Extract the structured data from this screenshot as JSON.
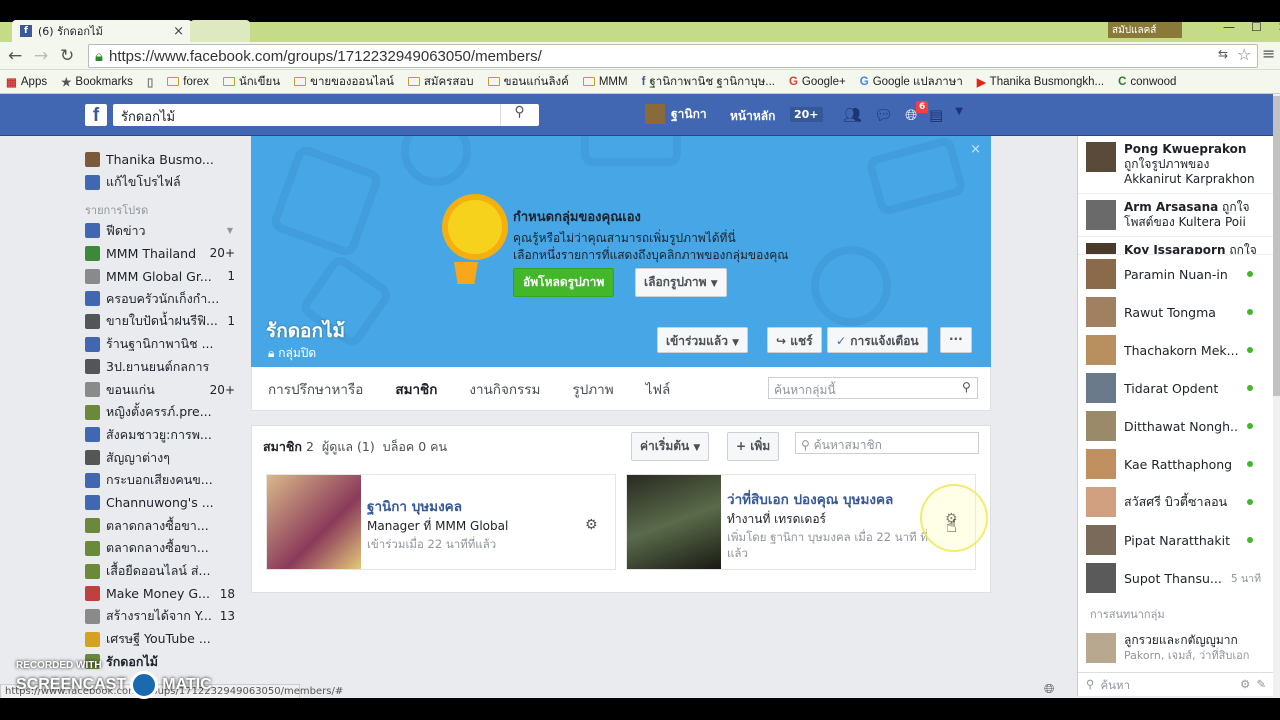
{
  "browser": {
    "tab_title": "(6) รักดอกไม้",
    "tab2_title": "",
    "extension_label": "สมัปแลคส์",
    "url": "https://www.facebook.com/groups/1712232949063050/members/",
    "status_url": "https://www.facebook.com/groups/1712232949063050/members/#",
    "bookmarks": [
      {
        "label": "Apps",
        "icon": "apps-icon"
      },
      {
        "label": "Bookmarks",
        "icon": "star-icon"
      },
      {
        "label": "",
        "icon": "page-icon"
      },
      {
        "label": "forex",
        "icon": "folder-icon"
      },
      {
        "label": "นักเขียน",
        "icon": "folder-icon"
      },
      {
        "label": "ขายของออนไลน์",
        "icon": "folder-icon"
      },
      {
        "label": "สมัครสอบ",
        "icon": "folder-icon"
      },
      {
        "label": "ขอนแก่นลิงค์",
        "icon": "folder-icon"
      },
      {
        "label": "MMM",
        "icon": "folder-icon"
      },
      {
        "label": "ฐานิกาพานิช ฐานิกาบุษ...",
        "icon": "facebook-icon"
      },
      {
        "label": "Google+",
        "icon": "googleplus-icon"
      },
      {
        "label": "Google แปลภาษา",
        "icon": "translate-icon"
      },
      {
        "label": "Thanika Busmongkh...",
        "icon": "youtube-icon"
      },
      {
        "label": "conwood",
        "icon": "conwood-icon"
      }
    ]
  },
  "fb": {
    "search_value": "รักดอกไม้",
    "user_name": "ฐานิกา",
    "home_label": "หน้าหลัก",
    "home_count": "20+",
    "notif_count": "6"
  },
  "left": {
    "profile_name": "Thanika Busmo...",
    "edit_profile": "แก้ไขโปรไฟล์",
    "favorites_heading": "รายการโปรด",
    "items": [
      {
        "label": "ฟีดข่าว",
        "count": "",
        "color": "#4267b2",
        "icon": "news-feed-icon"
      },
      {
        "label": "MMM Thailand",
        "count": "20+",
        "color": "#3a8a3a",
        "icon": "group-icon"
      },
      {
        "label": "MMM Global Gr...",
        "count": "1",
        "color": "#8a8a8a",
        "icon": "globe-icon"
      },
      {
        "label": "ครอบครัวนักเก็งกำ...",
        "count": "",
        "color": "#4267b2",
        "icon": "group-icon"
      },
      {
        "label": "ขายใบปัดน้ำฝนรีฟิ...",
        "count": "1",
        "color": "#555",
        "icon": "page-icon"
      },
      {
        "label": "ร้านฐานิกาพานิช ...",
        "count": "",
        "color": "#4267b2",
        "icon": "group-icon"
      },
      {
        "label": "3ป.ยานยนต์กลการ",
        "count": "",
        "color": "#555",
        "icon": "page-icon"
      },
      {
        "label": "ขอนแก่น",
        "count": "20+",
        "color": "#8a8a8a",
        "icon": "globe-icon"
      },
      {
        "label": "หญิงตั้งครรภ์.pre...",
        "count": "",
        "color": "#6a8a3a",
        "icon": "puzzle-icon"
      },
      {
        "label": "สังคมชาวยู:การพ...",
        "count": "",
        "color": "#4267b2",
        "icon": "group-icon"
      },
      {
        "label": "สัญญาต่างๆ",
        "count": "",
        "color": "#555",
        "icon": "notes-icon"
      },
      {
        "label": "กระบอกเสียงคนข...",
        "count": "",
        "color": "#4267b2",
        "icon": "megaphone-icon"
      },
      {
        "label": "Channuwong's ...",
        "count": "",
        "color": "#4267b2",
        "icon": "group-icon"
      },
      {
        "label": "ตลาดกลางซื้อขา...",
        "count": "",
        "color": "#6a8a3a",
        "icon": "puzzle-icon"
      },
      {
        "label": "ตลาดกลางซื้อขา...",
        "count": "",
        "color": "#6a8a3a",
        "icon": "puzzle-icon"
      },
      {
        "label": "เสื้อยืดออนไลน์ ส่...",
        "count": "",
        "color": "#6a8a3a",
        "icon": "puzzle-icon"
      },
      {
        "label": "Make Money G...",
        "count": "18",
        "color": "#c04040",
        "icon": "gift-icon"
      },
      {
        "label": "สร้างรายได้จาก Y...",
        "count": "13",
        "color": "#8a8a8a",
        "icon": "globe-icon"
      },
      {
        "label": "เศรษฐี YouTube ...",
        "count": "",
        "color": "#d8a020",
        "icon": "coin-icon"
      },
      {
        "label": "รักดอกไม้",
        "count": "",
        "color": "#6a8a3a",
        "icon": "plant-icon"
      }
    ]
  },
  "cover": {
    "title": "กำหนดกลุ่มของคุณเอง",
    "text_line1": "คุณรู้หรือไม่ว่าคุณสามารถเพิ่มรูปภาพได้ที่นี่",
    "text_line2": "เลือกหนึ่งรายการที่แสดงถึงบุคลิกภาพของกลุ่มของคุณ",
    "upload_btn": "อัพโหลดรูปภาพ",
    "choose_btn": "เลือกรูปภาพ",
    "group_name": "รักดอกไม้",
    "privacy": "กลุ่มปิด",
    "joined_btn": "เข้าร่วมแล้ว",
    "share_btn": "แชร์",
    "notif_btn": "การแจ้งเตือน",
    "more_btn": "···"
  },
  "tabs": [
    "การปรึกษาหารือ",
    "สมาชิก",
    "งานกิจกรรม",
    "รูปภาพ",
    "ไฟล์"
  ],
  "group_search_placeholder": "ค้นหากลุ่มนี้",
  "members": {
    "label_members": "สมาชิก",
    "members_count": "2",
    "label_admins": "ผู้ดูแล",
    "admins_count": "(1)",
    "label_blocked": "บล็อค",
    "blocked_count": "0",
    "blocked_unit": "คน",
    "default_btn": "ค่าเริ่มต้น",
    "add_btn": "+ เพิ่ม",
    "search_placeholder": "ค้นหาสมาชิก",
    "cards": [
      {
        "name": "ฐานิกา บุษมงคล",
        "sub": "Manager ที่ MMM Global",
        "meta": "เข้าร่วมเมื่อ 22 นาทีที่แล้ว"
      },
      {
        "name": "ว่าที่สิบเอก ปองคุณ บุษมงคล",
        "sub": "ทำงานที่ เทรดเดอร์",
        "meta": "เพิ่มโดย ฐานิกา บุษมงคล เมื่อ 22 นาที ที่แล้ว"
      }
    ]
  },
  "right": {
    "ticker": [
      {
        "name": "Pong Kwueprakon",
        "text": "ถูกใจรูปภาพของ Akkanirut Karprakhon"
      },
      {
        "name": "Arm Arsasana",
        "text": "ถูกใจโพสต์ของ Kultera Poii"
      },
      {
        "name": "Koy Issaraporn",
        "text": "ถูกใจ"
      }
    ],
    "contacts": [
      {
        "name": "Paramin Nuan-in",
        "status": "online"
      },
      {
        "name": "Rawut Tongma",
        "status": "online"
      },
      {
        "name": "Thachakorn Mek...",
        "status": "online"
      },
      {
        "name": "Tidarat Opdent",
        "status": "online"
      },
      {
        "name": "Ditthawat Nongh...",
        "status": "online"
      },
      {
        "name": "Kae Ratthaphong",
        "status": "online"
      },
      {
        "name": "สวัสศรี บิวตี้ซาลอน",
        "status": "online"
      },
      {
        "name": "Pipat Naratthakit",
        "status": "online"
      },
      {
        "name": "Supot Thansu...",
        "status": "5 นาที"
      }
    ],
    "group_chats_heading": "การสนทนากลุ่ม",
    "group_chat_name": "ลูกรวยและกตัญญูมาก",
    "group_chat_members": "Pakorn, เจมส์, ว่าที่สิบเอก",
    "chat_search_placeholder": "ค้นหา"
  },
  "watermark": {
    "line1": "RECORDED WITH",
    "line2": "SCREENCAST",
    "line3": "MATIC"
  }
}
